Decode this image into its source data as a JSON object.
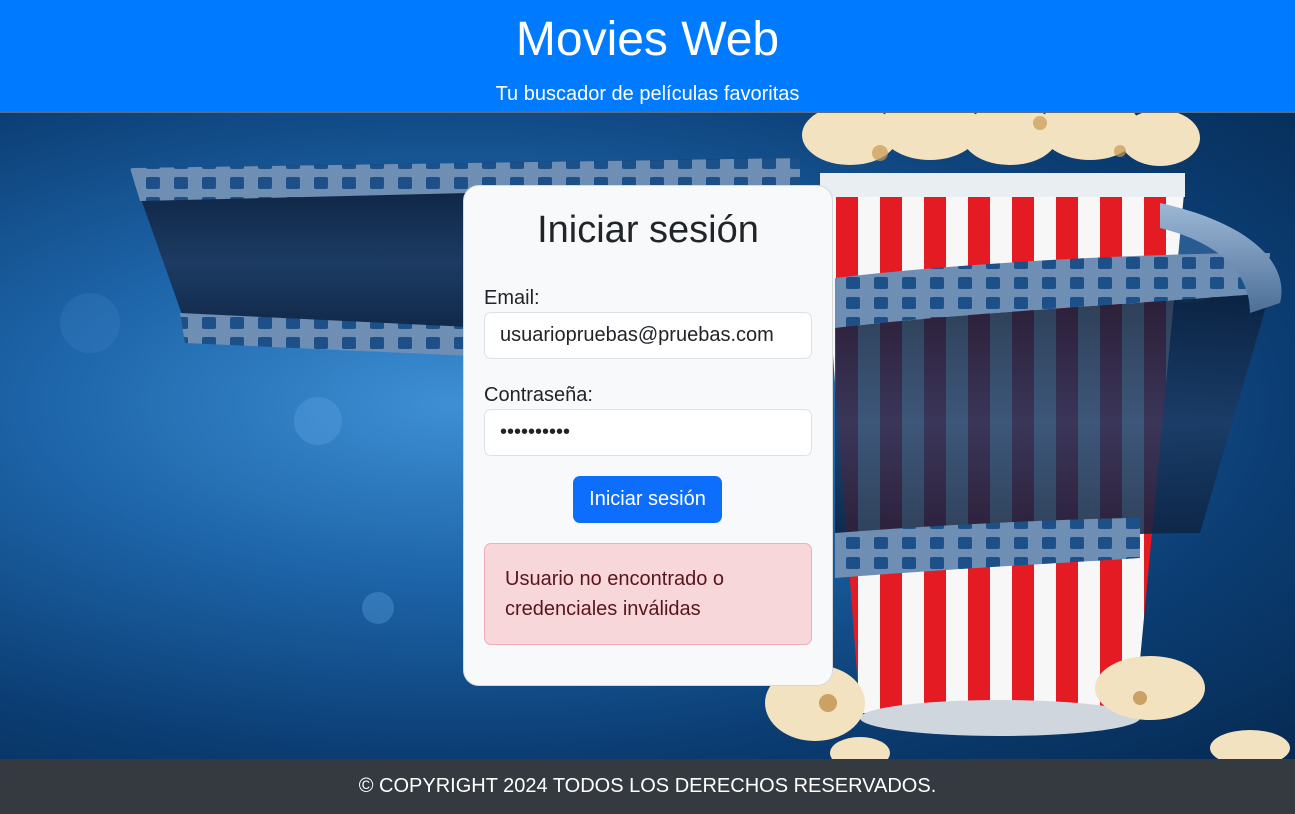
{
  "header": {
    "title": "Movies Web",
    "subtitle": "Tu buscador de películas favoritas"
  },
  "login": {
    "title": "Iniciar sesión",
    "email_label": "Email:",
    "email_value": "usuariopruebas@pruebas.com",
    "password_label": "Contraseña:",
    "password_value": "••••••••••",
    "submit_label": "Iniciar sesión",
    "error_message": "Usuario no encontrado o credenciales inválidas"
  },
  "footer": {
    "copyright": "© COPYRIGHT 2024 TODOS LOS DERECHOS RESERVADOS."
  },
  "colors": {
    "header_bg": "#007bff",
    "button_bg": "#0d6efd",
    "alert_bg": "#f8d7da",
    "alert_text": "#58151c",
    "footer_bg": "#343a40"
  }
}
